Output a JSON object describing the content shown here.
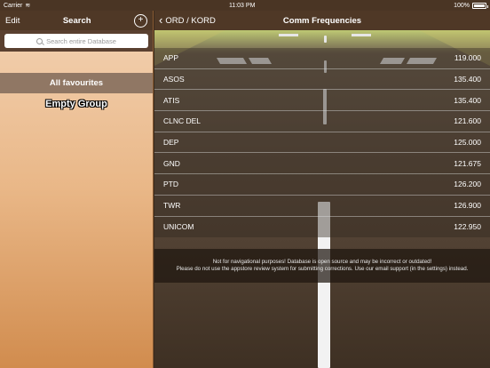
{
  "status_bar": {
    "carrier": "Carrier",
    "time": "11:03 PM",
    "battery": "100%"
  },
  "sidebar": {
    "edit_label": "Edit",
    "title": "Search",
    "search_placeholder": "Search entire Database",
    "group_label": "All favourites",
    "empty_label": "Empty Group"
  },
  "main": {
    "back_label": "ORD / KORD",
    "title": "Comm Frequencies",
    "frequencies": [
      {
        "name": "APP",
        "value": "119.000"
      },
      {
        "name": "ASOS",
        "value": "135.400"
      },
      {
        "name": "ATIS",
        "value": "135.400"
      },
      {
        "name": "CLNC DEL",
        "value": "121.600"
      },
      {
        "name": "DEP",
        "value": "125.000"
      },
      {
        "name": "GND",
        "value": "121.675"
      },
      {
        "name": "PTD",
        "value": "126.200"
      },
      {
        "name": "TWR",
        "value": "126.900"
      },
      {
        "name": "UNICOM",
        "value": "122.950"
      }
    ],
    "disclaimer_line1": "Not for navigational purposes! Database is open source and may be incorrect or outdated!",
    "disclaimer_line2": "Please do not use the appstore review system for submitting corrections. Use our email support (in the settings) instead."
  }
}
